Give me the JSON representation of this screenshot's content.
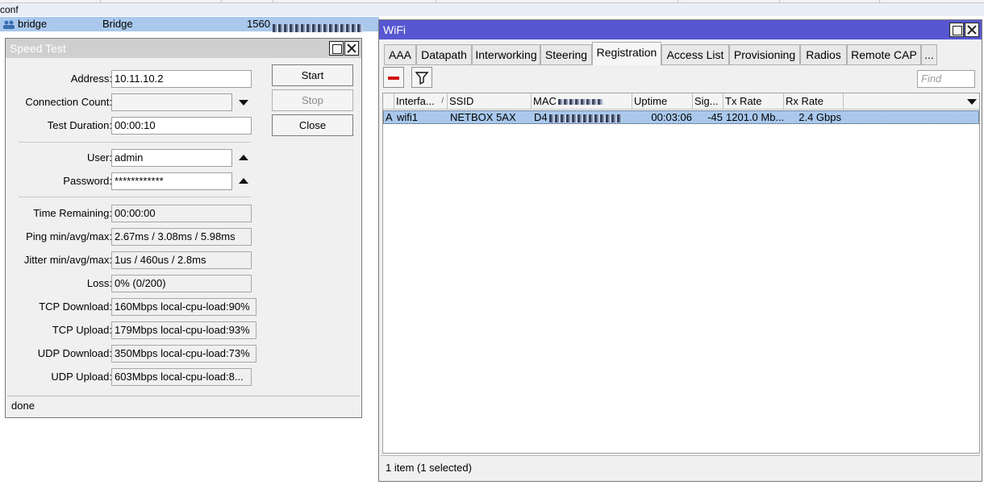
{
  "background_list": {
    "section_label": "conf",
    "row": {
      "name": "bridge",
      "type": "Bridge",
      "mtu": "1560"
    }
  },
  "speed_test": {
    "title": "Speed Test",
    "address_label": "Address:",
    "address_value": "10.11.10.2",
    "connection_count_label": "Connection Count:",
    "connection_count_value": "",
    "test_duration_label": "Test Duration:",
    "test_duration_value": "00:00:10",
    "user_label": "User:",
    "user_value": "admin",
    "password_label": "Password:",
    "password_value": "************",
    "time_remaining_label": "Time Remaining:",
    "time_remaining_value": "00:00:00",
    "ping_label": "Ping min/avg/max:",
    "ping_value": "2.67ms / 3.08ms / 5.98ms",
    "jitter_label": "Jitter min/avg/max:",
    "jitter_value": "1us / 460us / 2.8ms",
    "loss_label": "Loss:",
    "loss_value": "0% (0/200)",
    "tcp_download_label": "TCP Download:",
    "tcp_download_value": "160Mbps local-cpu-load:90%",
    "tcp_upload_label": "TCP Upload:",
    "tcp_upload_value": "179Mbps local-cpu-load:93%",
    "udp_download_label": "UDP Download:",
    "udp_download_value": "350Mbps local-cpu-load:73%",
    "udp_upload_label": "UDP Upload:",
    "udp_upload_value": "603Mbps local-cpu-load:8...",
    "buttons": {
      "start": "Start",
      "stop": "Stop",
      "close": "Close"
    },
    "status": "done"
  },
  "wifi": {
    "title": "WiFi",
    "tabs": [
      "AAA",
      "Datapath",
      "Interworking",
      "Steering",
      "Registration",
      "Access List",
      "Provisioning",
      "Radios",
      "Remote CAP",
      "..."
    ],
    "active_tab": "Registration",
    "find_placeholder": "Find",
    "columns": [
      "Interfa...",
      "SSID",
      "MAC",
      "Uptime",
      "Sig...",
      "Tx Rate",
      "Rx Rate"
    ],
    "rows": [
      {
        "flag": "A",
        "interface": "wifi1",
        "ssid": "NETBOX 5AX",
        "mac": "D4",
        "uptime": "00:03:06",
        "signal": "-45",
        "tx_rate": "1201.0 Mb...",
        "rx_rate": "2.4 Gbps"
      }
    ],
    "status": "1 item (1 selected)"
  },
  "colors": {
    "wifi_titlebar": "#5757d2",
    "inactive_titlebar": "#cfcfcf",
    "selection": "#a9c8ec",
    "remove_icon": "#d01010"
  }
}
